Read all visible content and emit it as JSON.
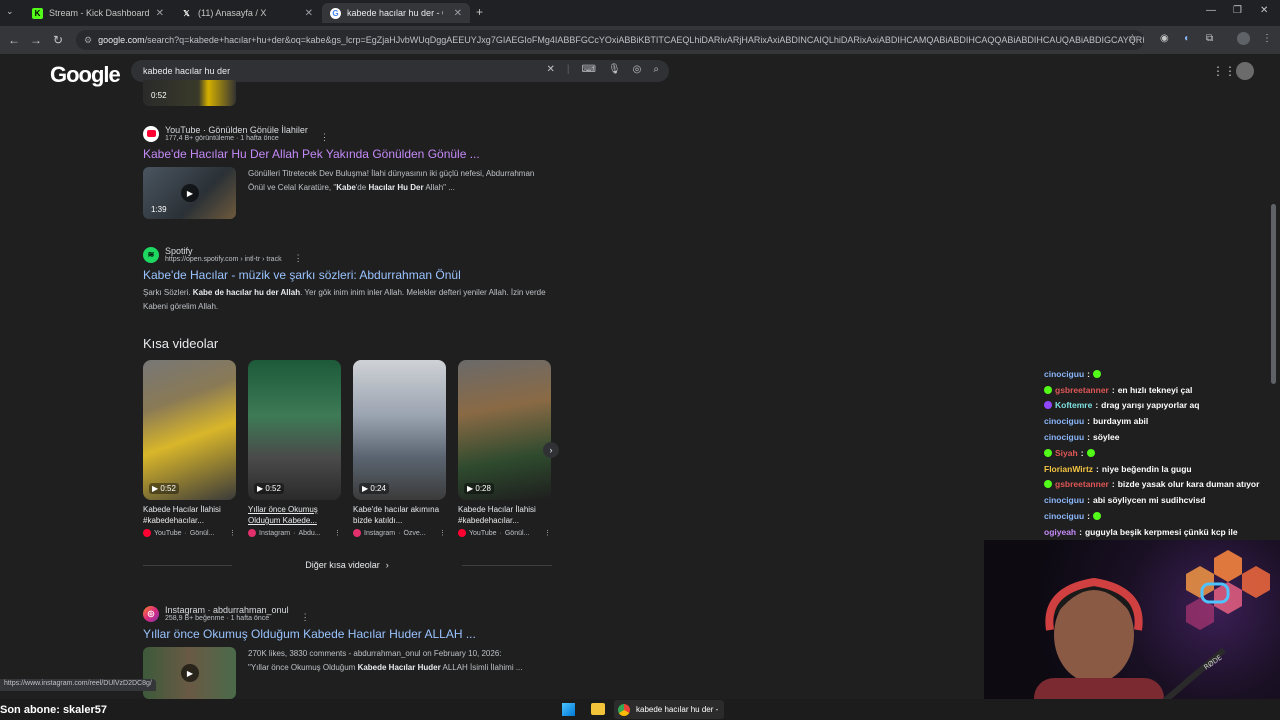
{
  "tabs": [
    {
      "label": "Stream - Kick Dashboard",
      "icon": "kick-icon"
    },
    {
      "label": "(11) Anasayfa / X",
      "icon": "x-icon"
    },
    {
      "label": "kabede hacılar hu der - Go",
      "icon": "google-icon"
    }
  ],
  "address": {
    "host": "google.com",
    "path": "/search?q=kabede+hacılar+hu+der&oq=kabe&gs_lcrp=EgZjaHJvbWUqDggAEEUYJxg7GIAEGIoFMg4IABBFGCcYOxiABBiKBTITCAEQLhiDARivARjHARixAxiABDINCAIQLhiDARixAxiABDIHCAMQABiABDIHCAQQABiABDIHCAUQABiABDIGCAYQRRg9MgYIBxB..."
  },
  "search": {
    "logo": "Google",
    "query": "kabede hacılar hu der"
  },
  "top_thumb_duration": "0:52",
  "results": [
    {
      "source": "YouTube · Gönülden Gönüle İlahiler",
      "meta": "177,4 B+ görüntüleme · 1 hafta önce",
      "title": "Kabe'de Hacılar Hu Der Allah Pek Yakında Gönülden Gönüle ...",
      "snippet_pre": "Gönülleri Titretecek Dev Buluşma! İlahi dünyasının iki güçlü nefesi, Abdurrahman Önül ve Celal Karatüre, \"",
      "snippet_b1": "Kabe",
      "snippet_mid": "'de ",
      "snippet_b2": "Hacılar Hu Der",
      "snippet_post": " Allah\" ...",
      "duration": "1:39"
    },
    {
      "source": "Spotify",
      "meta": "https://open.spotify.com › intl-tr › track",
      "title": "Kabe'de Hacılar - müzik ve şarkı sözleri: Abdurrahman Önül",
      "snippet_pre": "Şarkı Sözleri. ",
      "snippet_b1": "Kabe de hacılar hu der Allah",
      "snippet_post": ". Yer gök inim inim inler Allah. Melekler defteri yeniler Allah. İzin verde Kabeni görelim Allah."
    },
    {
      "source": "Instagram · abdurrahman_onul",
      "meta": "258,9 B+ beğenme · 1 hafta önce",
      "title": "Yıllar önce Okumuş Olduğum Kabede Hacılar Huder ALLAH ...",
      "snippet_l1": "270K likes, 3830 comments - abdurrahman_onul on February 10, 2026:",
      "snippet_l2_pre": "\"Yıllar önce Okumuş Olduğum ",
      "snippet_l2_b": "Kabede Hacılar Huder",
      "snippet_l2_post": " ALLAH İsimli İlahimi ..."
    }
  ],
  "shorts": {
    "heading": "Kısa videolar",
    "more": "Diğer kısa videolar",
    "items": [
      {
        "duration": "0:52",
        "title": "Kabede Hacılar İlahisi #kabedehacılar...",
        "platform": "YouTube",
        "channel": "Gönül...",
        "color": "#ff0033"
      },
      {
        "duration": "0:52",
        "title": "Yıllar önce Okumuş Olduğum Kabede...",
        "platform": "Instagram",
        "channel": "Abdu...",
        "color": "#e1306c"
      },
      {
        "duration": "0:24",
        "title": "Kabe'de hacılar akımına bizde katıldı...",
        "platform": "Instagram",
        "channel": "Özve...",
        "color": "#e1306c"
      },
      {
        "duration": "0:28",
        "title": "Kabede Hacılar İlahisi #kabedehacılar...",
        "platform": "YouTube",
        "channel": "Gönül...",
        "color": "#ff0033"
      }
    ]
  },
  "chat": [
    {
      "user": "cinociguu",
      "msg": "",
      "color": "#8ab4f8",
      "badge": ""
    },
    {
      "user": "gsbreetanner",
      "msg": "en hızlı tekneyi çal",
      "color": "#e05656",
      "badge": "#53fc18"
    },
    {
      "user": "Koftemre",
      "msg": "drag yarışı yapıyorlar aq",
      "color": "#7ee0e0",
      "badge": "#9147ff"
    },
    {
      "user": "cinociguu",
      "msg": "burdayım abil",
      "color": "#8ab4f8",
      "badge": ""
    },
    {
      "user": "cinociguu",
      "msg": "söylee",
      "color": "#8ab4f8",
      "badge": ""
    },
    {
      "user": "Siyah",
      "msg": "",
      "color": "#e05656",
      "badge": "#53fc18"
    },
    {
      "user": "FlorianWirtz",
      "msg": "niye beğendin la gugu",
      "color": "#f5c542",
      "badge": ""
    },
    {
      "user": "gsbreetanner",
      "msg": "bizde yasak olur kara duman atıyor",
      "color": "#e05656",
      "badge": "#53fc18"
    },
    {
      "user": "cinociguu",
      "msg": "abi söyliycen mi sudihcvisd",
      "color": "#8ab4f8",
      "badge": ""
    },
    {
      "user": "cinociguu",
      "msg": "",
      "color": "#8ab4f8",
      "badge": ""
    },
    {
      "user": "ogiyeah",
      "msg": "guguyla beşik kerpmesi çünkü kcp ile",
      "color": "#c58af9",
      "badge": ""
    }
  ],
  "status_url": "https://www.instagram.com/reel/DUlVzD2DC8g/",
  "subscriber": "Son abone: skaler57",
  "taskbar_title": "kabede hacılar hu der -"
}
